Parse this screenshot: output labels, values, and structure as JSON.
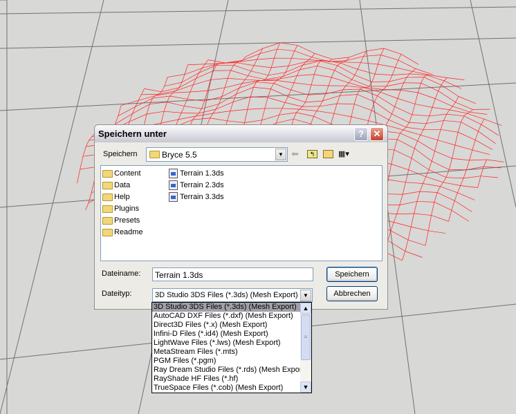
{
  "dialog": {
    "title": "Speichern unter",
    "help_label": "?",
    "close_label": "✕"
  },
  "save_in": {
    "label": "Speichern",
    "value": "Bryce 5.5"
  },
  "toolbar": {
    "back_icon": "back-arrow-icon",
    "up_icon": "folder-up-icon",
    "new_folder_icon": "new-folder-icon",
    "view_icon": "view-menu-icon"
  },
  "folders": [
    "Content",
    "Data",
    "Help",
    "Plugins",
    "Presets",
    "Readme"
  ],
  "files": [
    "Terrain 1.3ds",
    "Terrain 2.3ds",
    "Terrain 3.3ds"
  ],
  "filename": {
    "label": "Dateiname:",
    "value": "Terrain 1.3ds"
  },
  "filetype": {
    "label": "Dateityp:",
    "value": "3D Studio 3DS Files (*.3ds) (Mesh Export)",
    "options": [
      "3D Studio 3DS Files (*.3ds) (Mesh Export)",
      "AutoCAD DXF Files (*.dxf) (Mesh Export)",
      "Direct3D Files (*.x) (Mesh Export)",
      "Infini-D Files (*.id4) (Mesh Export)",
      "LightWave Files (*.lws) (Mesh Export)",
      "MetaStream Files (*.mts)",
      "PGM Files (*.pgm)",
      "Ray Dream Studio Files (*.rds) (Mesh Export)",
      "RayShade HF Files (*.hf)",
      "TrueSpace Files (*.cob) (Mesh Export)"
    ]
  },
  "buttons": {
    "save": "Speichern",
    "cancel": "Abbrechen"
  },
  "colors": {
    "mesh": "#ff2020",
    "grid": "#707070"
  }
}
